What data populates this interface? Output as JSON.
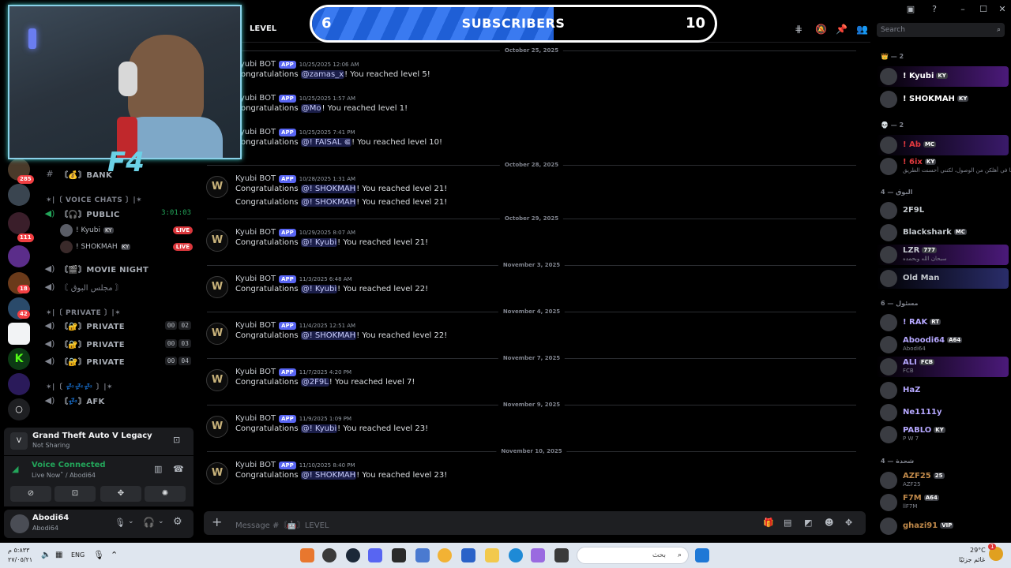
{
  "window": {
    "minimize": "–",
    "maximize": "☐",
    "close": "✕"
  },
  "subscribers": {
    "current": "6",
    "label": "SUBSCRIBERS",
    "goal": "10",
    "progress": 0.6
  },
  "channel": {
    "title": "LEVEL",
    "search_placeholder": "Search"
  },
  "rail": {
    "badges": [
      "285",
      "111",
      "18",
      "42"
    ]
  },
  "sidebar": {
    "bank_label": "〘💰〙BANK",
    "voice_category": "✶|〔 VOICE CHATS 〕|✶",
    "public": {
      "label": "〘🎧〙PUBLIC",
      "time": "3:01:03"
    },
    "voice_users": [
      {
        "name": "! Kyubi",
        "tag": "KY",
        "live": "LIVE"
      },
      {
        "name": "! SHOKMAH",
        "tag": "KY",
        "live": "LIVE"
      }
    ],
    "movie_night": "〘🎬〙MOVIE NIGHT",
    "arabic_channel": "〘 مجلس البوق 〙",
    "private_category": "✶|〔 PRIVATE 〕|✶",
    "privates": [
      {
        "label": "〘🔐〙PRIVATE",
        "a": "00",
        "b": "02"
      },
      {
        "label": "〘🔐〙PRIVATE",
        "a": "00",
        "b": "03"
      },
      {
        "label": "〘🔐〙PRIVATE",
        "a": "00",
        "b": "04"
      }
    ],
    "zz_category": "✶|〔 💤💤💤 〕|✶",
    "afk": "〘💤〙AFK"
  },
  "activity": {
    "title": "Grand Theft Auto V Legacy",
    "status": "Not Sharing"
  },
  "voice": {
    "status": "Voice Connected",
    "detail": "Live Now˚ / Abodi64"
  },
  "user": {
    "name": "Abodi64",
    "sub": "Abodi64"
  },
  "webcam": {
    "logo": "F4"
  },
  "messages": [
    {
      "type": "date",
      "text": "October 25, 2025"
    },
    {
      "type": "msg",
      "author": "Kyubi BOT",
      "app": "APP",
      "time": "10/25/2025 12:06 AM",
      "pre": "Congratulations ",
      "mention": "@zamas_x",
      "post": "! You reached level 5!"
    },
    {
      "type": "msg",
      "author": "Kyubi BOT",
      "app": "APP",
      "time": "10/25/2025 1:57 AM",
      "pre": "Congratulations ",
      "mention": "@Mo",
      "post": "! You reached level 1!"
    },
    {
      "type": "msg",
      "author": "Kyubi BOT",
      "app": "APP",
      "time": "10/25/2025 7:41 PM",
      "pre": "Congratulations ",
      "mention": "@!      FAISAL ⋐",
      "post": "! You reached level 10!"
    },
    {
      "type": "date",
      "text": "October 28, 2025"
    },
    {
      "type": "msg",
      "author": "Kyubi BOT",
      "app": "APP",
      "time": "10/28/2025 1:31 AM",
      "pre": "Congratulations ",
      "mention": "@! SHOKMAH",
      "post": "! You reached level 21!",
      "pre2": "Congratulations ",
      "mention2": "@! SHOKMAH",
      "post2": "! You reached level 21!"
    },
    {
      "type": "date",
      "text": "October 29, 2025"
    },
    {
      "type": "msg",
      "author": "Kyubi BOT",
      "app": "APP",
      "time": "10/29/2025 8:07 AM",
      "pre": "Congratulations ",
      "mention": "@! Kyubi",
      "post": "! You reached level 21!"
    },
    {
      "type": "date",
      "text": "November 3, 2025"
    },
    {
      "type": "msg",
      "author": "Kyubi BOT",
      "app": "APP",
      "time": "11/3/2025 6:48 AM",
      "pre": "Congratulations ",
      "mention": "@! Kyubi",
      "post": "! You reached level 22!"
    },
    {
      "type": "date",
      "text": "November 4, 2025"
    },
    {
      "type": "msg",
      "author": "Kyubi BOT",
      "app": "APP",
      "time": "11/4/2025 12:51 AM",
      "pre": "Congratulations ",
      "mention": "@! SHOKMAH",
      "post": "! You reached level 22!"
    },
    {
      "type": "date",
      "text": "November 7, 2025"
    },
    {
      "type": "msg",
      "author": "Kyubi BOT",
      "app": "APP",
      "time": "11/7/2025 4:20 PM",
      "pre": "Congratulations ",
      "mention": "@2F9L",
      "post": "! You reached level 7!"
    },
    {
      "type": "date",
      "text": "November 9, 2025"
    },
    {
      "type": "msg",
      "author": "Kyubi BOT",
      "app": "APP",
      "time": "11/9/2025 1:09 PM",
      "pre": "Congratulations ",
      "mention": "@! Kyubi",
      "post": "! You reached level 23!"
    },
    {
      "type": "date",
      "text": "November 10, 2025"
    },
    {
      "type": "msg",
      "author": "Kyubi BOT",
      "app": "APP",
      "time": "11/10/2025 8:40 PM",
      "pre": "Congratulations ",
      "mention": "@! SHOKMAH",
      "post": "! You reached level 23!"
    }
  ],
  "composer": {
    "placeholder": "Message #〘🤖〙LEVEL"
  },
  "members": {
    "sections": [
      {
        "label": "👑 — 2"
      },
      {
        "label": "💀 — 2"
      },
      {
        "label": "البوق — 4"
      },
      {
        "label": "مسئول — 6"
      },
      {
        "label": "شحدة — 4"
      }
    ],
    "list": [
      {
        "name": "! Kyubi",
        "tag": "KY",
        "sub": "",
        "color": "#ffffff",
        "highlight": "#4b1a7a"
      },
      {
        "name": "! SHOKMAH",
        "tag": "KY",
        "sub": "",
        "color": "#ffffff",
        "highlight": ""
      },
      {
        "name": "! Ab",
        "tag": "MC",
        "sub": "",
        "color": "#e0393e",
        "highlight": "#3a1a6a"
      },
      {
        "name": "! 6ix",
        "tag": "KY",
        "sub": "رايدنا في أهلكن من الوصول، لكنني أحسنت الطريق",
        "color": "#e0393e",
        "highlight": ""
      },
      {
        "name": "2F9L",
        "tag": "",
        "sub": "",
        "color": "#c4c9ce",
        "highlight": ""
      },
      {
        "name": "Blackshark",
        "tag": "MC",
        "sub": "",
        "color": "#c4c9ce",
        "highlight": ""
      },
      {
        "name": "LZR",
        "tag": "777",
        "sub": "سبحان الله وبحمده",
        "color": "#c4c9ce",
        "highlight": "#4b1a7a"
      },
      {
        "name": "Old Man",
        "tag": "",
        "sub": "",
        "color": "#c4c9ce",
        "highlight": "#2a2d6a"
      },
      {
        "name": "! RAK",
        "tag": "RT",
        "sub": "",
        "color": "#b6a8ff",
        "highlight": ""
      },
      {
        "name": "Aboodi64",
        "tag": "A64",
        "sub": "Abodi64",
        "color": "#b6a8ff",
        "highlight": ""
      },
      {
        "name": "ALI",
        "tag": "FCB",
        "sub": "FCB",
        "color": "#b6a8ff",
        "highlight": "#4b1a7a"
      },
      {
        "name": "HaZ",
        "tag": "",
        "sub": "",
        "color": "#b6a8ff",
        "highlight": ""
      },
      {
        "name": "Ne1111y",
        "tag": "",
        "sub": "",
        "color": "#b6a8ff",
        "highlight": ""
      },
      {
        "name": "PABLO",
        "tag": "KY",
        "sub": "P W 7",
        "color": "#b6a8ff",
        "highlight": ""
      },
      {
        "name": "AZF25",
        "tag": "25",
        "sub": "AZF25",
        "color": "#c0894a",
        "highlight": ""
      },
      {
        "name": "F7M",
        "tag": "A64",
        "sub": "llF7M",
        "color": "#c0894a",
        "highlight": ""
      },
      {
        "name": "ghazi91",
        "tag": "VIP",
        "sub": "",
        "color": "#c0894a",
        "highlight": ""
      }
    ]
  },
  "taskbar": {
    "left_top": "٥:٨٣٣ م",
    "left_bottom": "٢٧/٠٥/٢١",
    "lang": "ENG",
    "search": "بحث",
    "weather_temp": "29°C",
    "weather_desc": "غائم جزئيًا",
    "notif_count": "1"
  }
}
